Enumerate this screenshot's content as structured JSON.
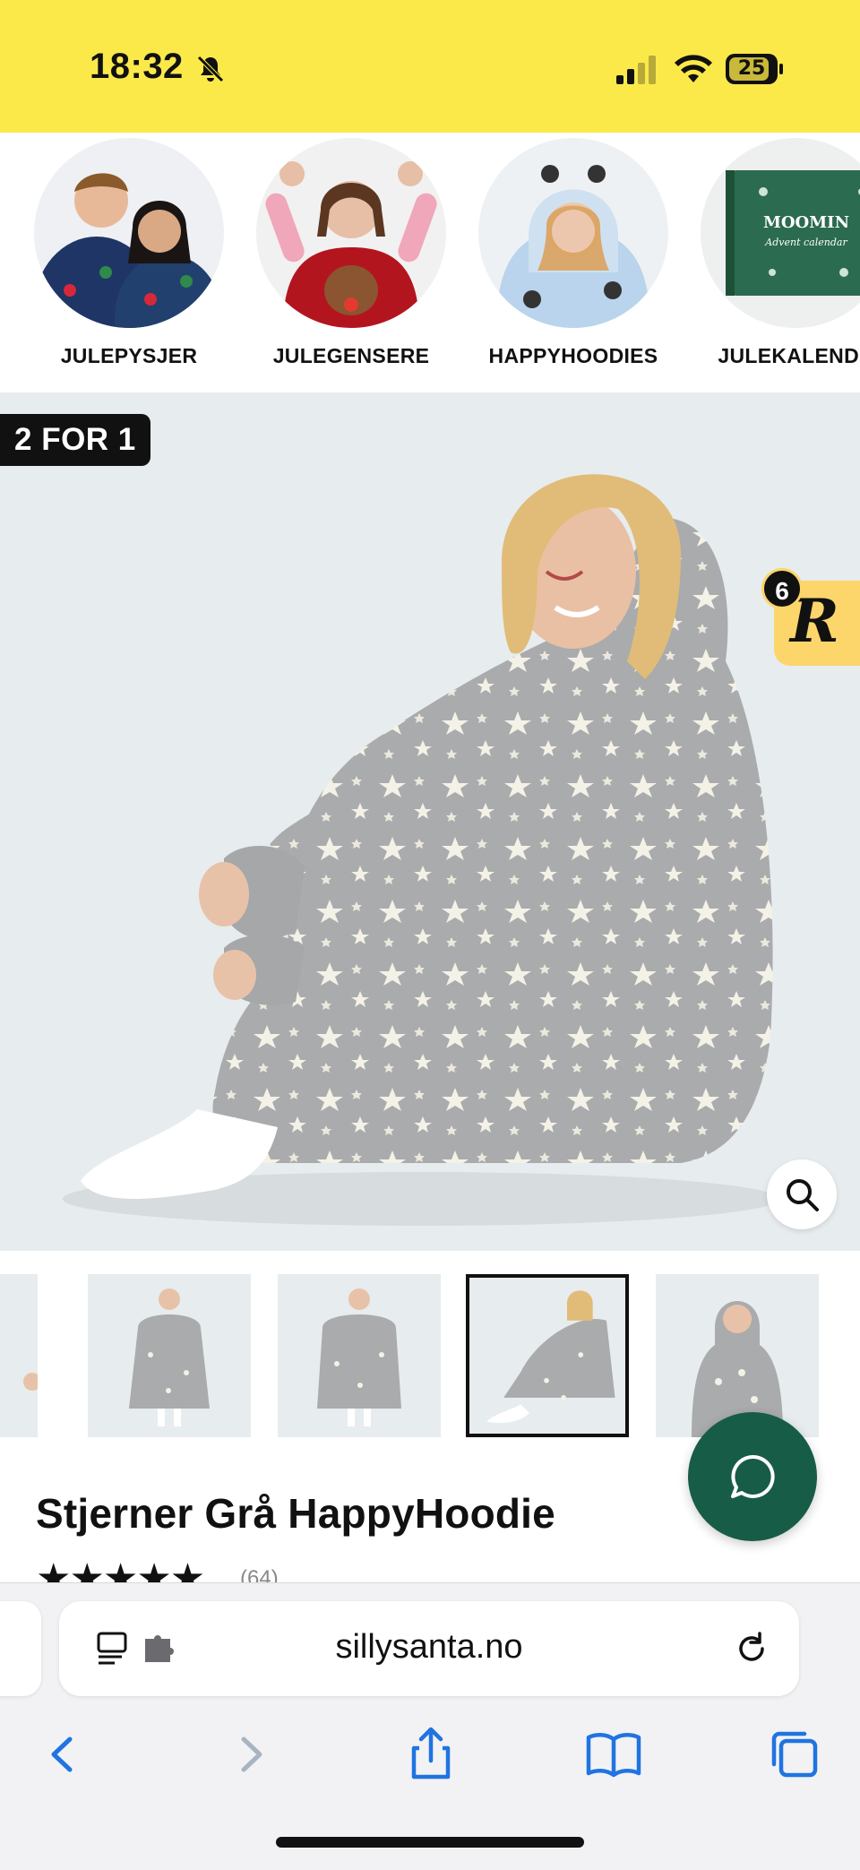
{
  "status_bar": {
    "time": "18:32",
    "battery": "25",
    "background": "#fbe94a"
  },
  "categories": [
    {
      "label": "JULEPYSJER",
      "icon": "people-photo"
    },
    {
      "label": "JULEGENSERE",
      "icon": "sweater-photo"
    },
    {
      "label": "HAPPYHOODIES",
      "icon": "hoodie-photo"
    },
    {
      "label": "JULEKALENDE",
      "icon": "calendar-box-photo"
    }
  ],
  "product": {
    "badge": "2 FOR 1",
    "rewards_count": "6",
    "rewards_letter": "R",
    "title": "Stjerner Grå HappyHoodie",
    "stars": "★★★★★",
    "rating_count": "(64)"
  },
  "thumbnails": [
    {
      "name": "thumb-1",
      "active": false
    },
    {
      "name": "thumb-2",
      "active": false
    },
    {
      "name": "thumb-3",
      "active": true
    },
    {
      "name": "thumb-4",
      "active": false
    }
  ],
  "browser": {
    "url": "sillysanta.no"
  },
  "colors": {
    "accent_yellow": "#fbe94a",
    "chat_green": "#175c47",
    "rewards_yellow": "#fcd56b",
    "ios_blue": "#1f74e0"
  }
}
